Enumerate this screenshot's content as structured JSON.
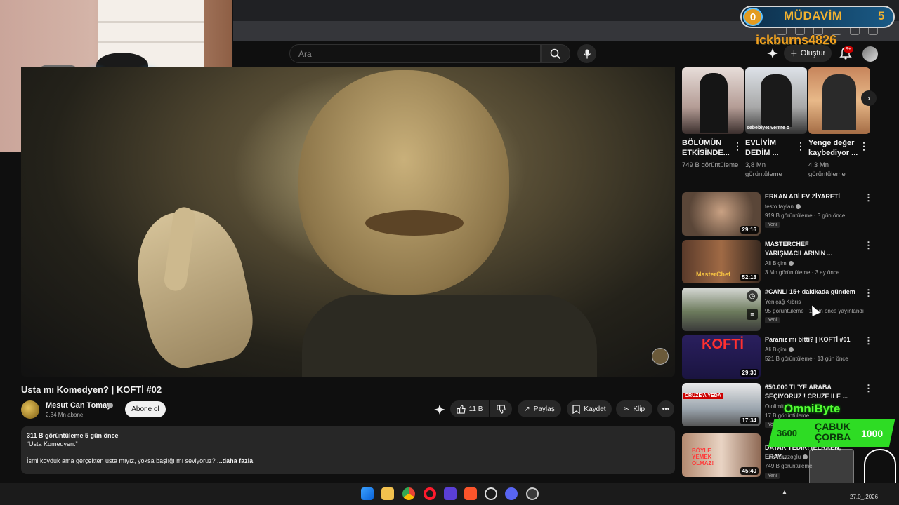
{
  "search": {
    "placeholder": "Ara"
  },
  "header": {
    "create_label": "Oluştur",
    "notification_badge": "9+"
  },
  "overlay": {
    "widget_count": "0",
    "widget_title": "MÜDAVİM",
    "widget_number": "5",
    "username": "ickburns4826",
    "omnibyte_label": "OmniByte",
    "omni_left": "3600",
    "omni_middle": "ÇABUK ÇORBA",
    "omni_right": "1000"
  },
  "video": {
    "title": "Usta mı Komedyen? | KOFTİ #02",
    "channel": "Mesut Can Tomay",
    "subscribers": "2,34 Mn abone",
    "subscribe_label": "Abone ol",
    "likes": "11 B",
    "share_label": "Paylaş",
    "save_label": "Kaydet",
    "clip_label": "Klip",
    "description_stats": "311 B görüntüleme  5 gün önce",
    "description_line1": "“Usta Komedyen.”",
    "description_line2": "İsmi koyduk ama gerçekten usta mıyız, yoksa başlığı mı seviyoruz? ",
    "description_more": "...daha fazla"
  },
  "shorts": [
    {
      "title": "BÖLÜMÜN ETKİSİNDE...",
      "views": "749 B görüntüleme",
      "overlay_text": ""
    },
    {
      "title": "EVLİYİM DEDİM ...",
      "views": "3,8 Mn görüntüleme",
      "overlay_text": "sebebiyet verme o"
    },
    {
      "title": "Yenge değer kaybediyor ...",
      "views": "4,3 Mn görüntüleme",
      "overlay_text": ""
    }
  ],
  "recommendations": [
    {
      "title": "ERKAN ABİ EV ZİYARETİ",
      "channel": "testo taylan",
      "meta": "919 B görüntüleme · 3 gün önce",
      "badge": "Yeni",
      "duration": "29:16"
    },
    {
      "title": "MASTERCHEF YARIŞMACILARININ ...",
      "channel": "Ali Biçim",
      "meta": "3 Mn görüntüleme · 3 ay önce",
      "badge": "",
      "duration": "52:18"
    },
    {
      "title": "#CANLI 15+ dakikada gündem",
      "channel": "Yeniçağ Kıbrıs",
      "meta": "95 görüntüleme · 1 gün önce yayınlandı",
      "badge": "Yeni",
      "duration": ""
    },
    {
      "title": "Paranız mı bitti? | KOFTİ #01",
      "channel": "Ali Biçim",
      "meta": "521 B görüntüleme · 13 gün önce",
      "badge": "",
      "duration": "29:30"
    },
    {
      "title": "650.000 TL'YE ARABA SEÇİYORUZ ! CRUZE İLE ...",
      "channel": "Otolimit",
      "meta": "17 B görüntüleme",
      "badge": "Yeni",
      "duration": "17:34"
    },
    {
      "title": "DAYAK YEDİK! (ELRAEN, ERAY...",
      "channel": "Enis Kirazoglu",
      "meta": "749 B görüntüleme",
      "badge": "Yeni",
      "duration": "45:40"
    }
  ],
  "thumb_text": {
    "kofti": "KOFTİ",
    "masterchef": "MasterChef",
    "cruze": "CRUZE'A YEDA",
    "boyle": "BÖYLE YEMEK OLMAZ!"
  },
  "taskbar": {
    "date": "27.0_.2026"
  },
  "colors": {
    "background": "#0f0f0f",
    "accent": "#cc0000",
    "widget_gold": "#f2b230",
    "omnibyte_green": "#2edc24"
  }
}
